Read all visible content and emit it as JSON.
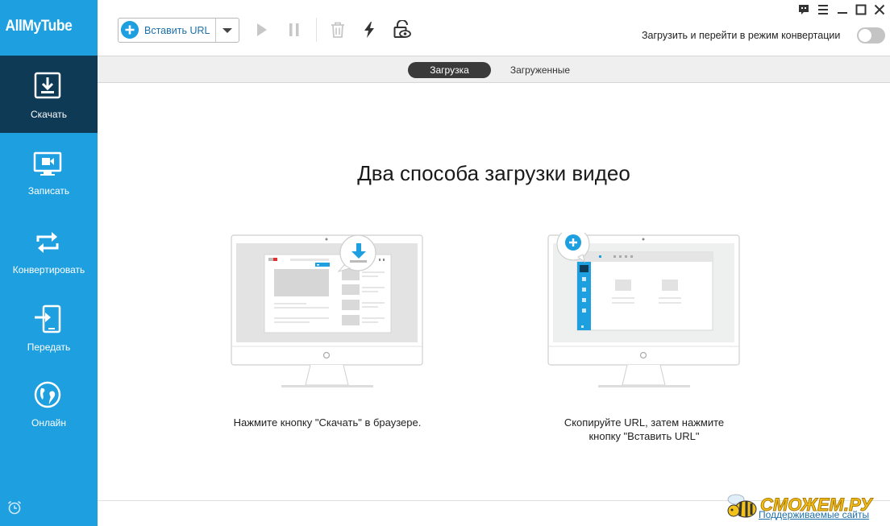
{
  "app": {
    "logo": "AllMyTube"
  },
  "sidebar": {
    "items": [
      {
        "label": "Скачать",
        "icon": "download-icon",
        "active": true
      },
      {
        "label": "Записать",
        "icon": "record-screen-icon",
        "active": false
      },
      {
        "label": "Конвертировать",
        "icon": "convert-icon",
        "active": false
      },
      {
        "label": "Передать",
        "icon": "transfer-icon",
        "active": false
      },
      {
        "label": "Онлайн",
        "icon": "globe-icon",
        "active": false
      }
    ],
    "bottom_icon": "alarm-clock-icon"
  },
  "toolbar": {
    "paste_url_label": "Вставить URL",
    "icons": [
      "play-icon",
      "pause-icon",
      "trash-icon",
      "lightning-icon",
      "private-mode-icon"
    ],
    "convert_mode_label": "Загрузить и перейти в режим конвертации",
    "convert_mode_on": false
  },
  "window_controls": [
    "feedback-icon",
    "menu-icon",
    "minimize-icon",
    "maximize-icon",
    "close-icon"
  ],
  "tabs": [
    {
      "label": "Загрузка",
      "active": true
    },
    {
      "label": "Загруженные",
      "active": false
    }
  ],
  "main": {
    "title": "Два способа загрузки видео",
    "method_1_caption": "Нажмите кнопку \"Скачать\" в браузере.",
    "method_2_caption_line1": "Скопируйте URL, затем нажмите",
    "method_2_caption_line2": "кнопку \"Вставить URL\"",
    "supported_sites": "Поддерживаемые сайты",
    "watermark": "СМОЖЕМ.РУ"
  },
  "colors": {
    "sidebar": "#1e9fe0",
    "sidebar_active": "#0e3a56",
    "accent": "#1e9fe0",
    "tab_active": "#3a3a3a"
  }
}
